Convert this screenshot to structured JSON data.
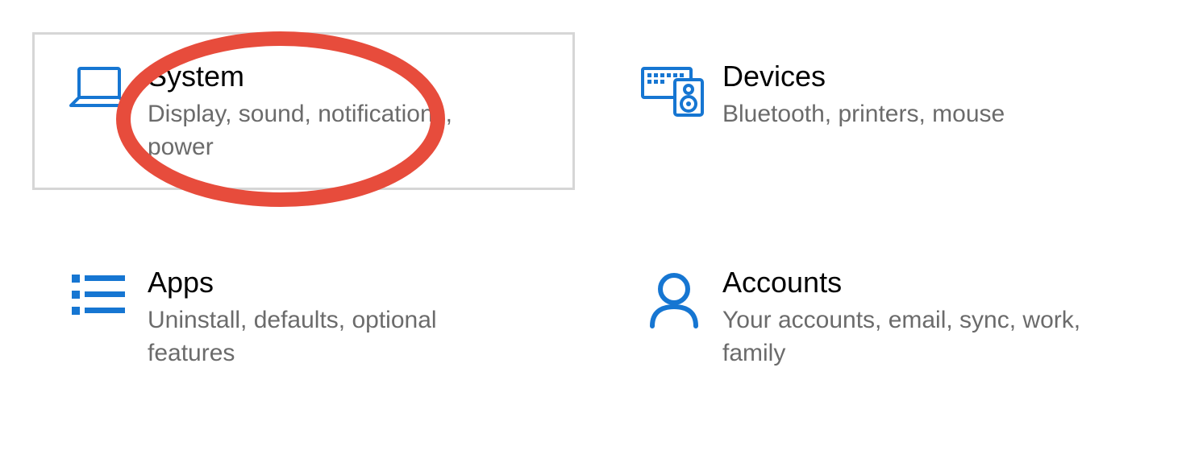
{
  "colors": {
    "icon_blue": "#1676d2",
    "annotation_red": "#e74c3c",
    "title_black": "#000000",
    "desc_gray": "#6b6b6b",
    "selected_border": "#d6d6d6"
  },
  "tiles": [
    {
      "id": "system",
      "title": "System",
      "description": "Display, sound, notifications, power",
      "selected": true,
      "annotated": true
    },
    {
      "id": "devices",
      "title": "Devices",
      "description": "Bluetooth, printers, mouse",
      "selected": false,
      "annotated": false
    },
    {
      "id": "apps",
      "title": "Apps",
      "description": "Uninstall, defaults, optional features",
      "selected": false,
      "annotated": false
    },
    {
      "id": "accounts",
      "title": "Accounts",
      "description": "Your accounts, email, sync, work, family",
      "selected": false,
      "annotated": false
    }
  ]
}
